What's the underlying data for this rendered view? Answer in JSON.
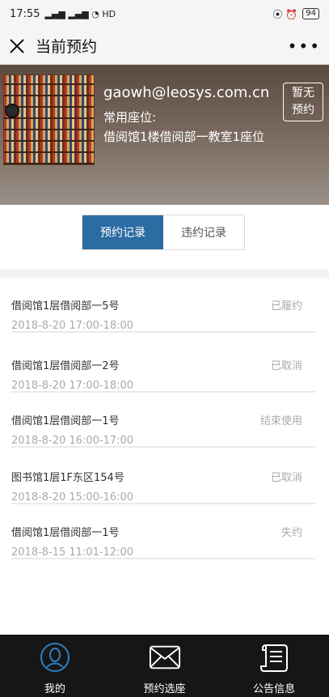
{
  "statusbar": {
    "time": "17:55",
    "left_icons": "▂▄▆ ▂▄▆ ◔ HD",
    "right_icons": "⦿ ⏰",
    "battery": "94"
  },
  "navbar": {
    "title": "当前预约",
    "more": "•••",
    "close_icon": "close-icon"
  },
  "profile": {
    "email": "gaowh@leosys.com.cn",
    "fav_label": "常用座位:",
    "fav_seat": "借阅馆1楼借阅部一教室1座位",
    "booking_btn": "暂无\n预约"
  },
  "tabs": [
    {
      "label": "预约记录",
      "active": true
    },
    {
      "label": "违约记录",
      "active": false
    }
  ],
  "records": [
    {
      "location": "借阅馆1层借阅部一5号",
      "time": "2018-8-20 17:00-18:00",
      "status": "已履约"
    },
    {
      "location": "借阅馆1层借阅部一2号",
      "time": "2018-8-20 17:00-18:00",
      "status": "已取消"
    },
    {
      "location": "借阅馆1层借阅部一1号",
      "time": "2018-8-20 16:00-17:00",
      "status": "结束使用"
    },
    {
      "location": "图书馆1层1F东区154号",
      "time": "2018-8-20 15:00-16:00",
      "status": "已取消"
    },
    {
      "location": "借阅馆1层借阅部一1号",
      "time": "2018-8-15 11:01-12:00",
      "status": "失约"
    }
  ],
  "bottom_nav": [
    {
      "label": "我的",
      "icon": "user-icon",
      "active": true
    },
    {
      "label": "预约选座",
      "icon": "envelope-icon",
      "active": false
    },
    {
      "label": "公告信息",
      "icon": "scroll-icon",
      "active": false
    }
  ],
  "colors": {
    "accent": "#2d6ca3",
    "active_icon": "#2f7fc1",
    "bottom_bg": "#161616"
  }
}
